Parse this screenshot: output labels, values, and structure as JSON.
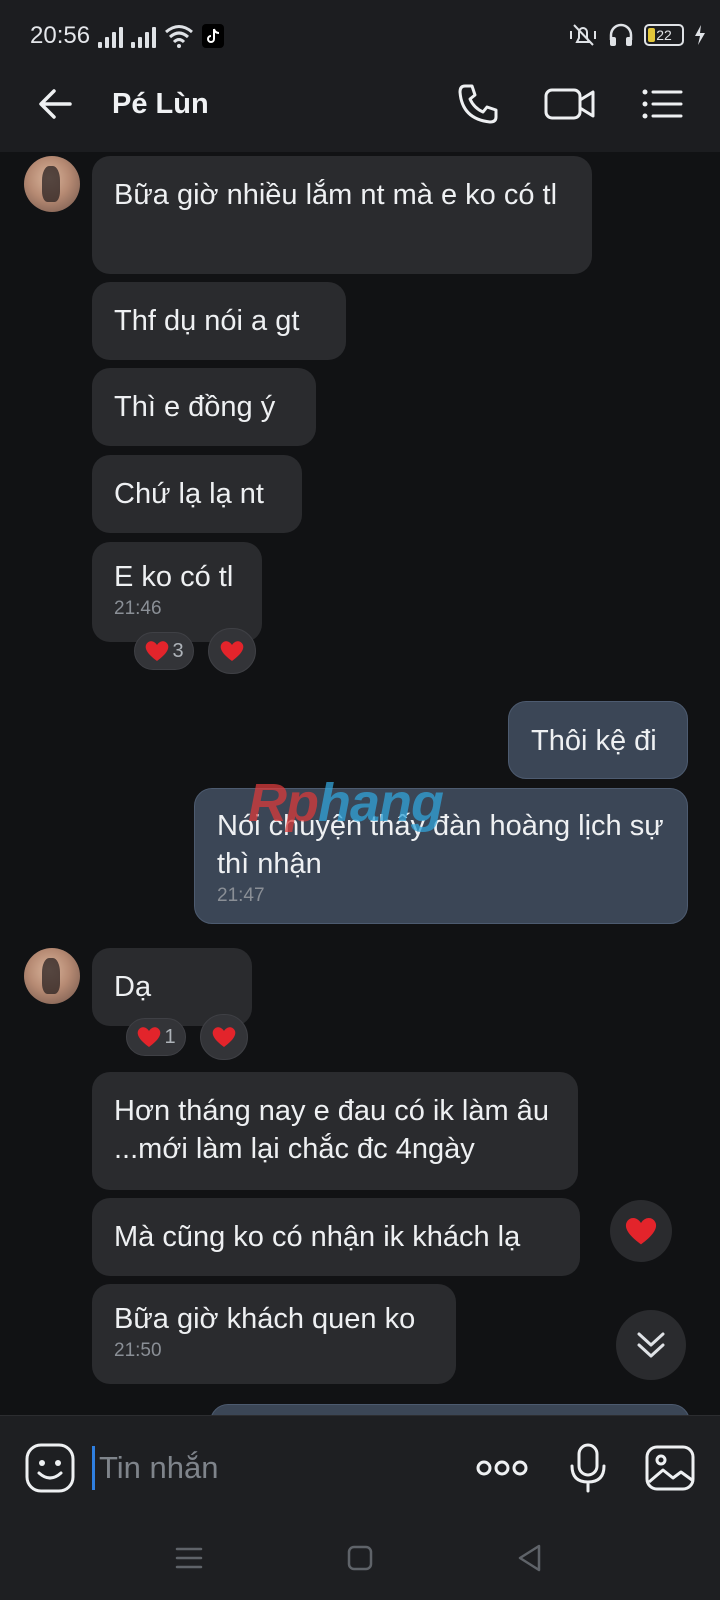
{
  "status_bar": {
    "time": "20:56",
    "battery": "22"
  },
  "header": {
    "contact_name": "Pé Lùn"
  },
  "messages": {
    "m1": {
      "text": "Bữa giờ nhiều lắm nt mà e ko có tl"
    },
    "m2": {
      "text": "Thf dụ nói a gt"
    },
    "m3": {
      "text": "Thì e đồng ý"
    },
    "m4": {
      "text": "Chứ lạ lạ nt"
    },
    "m5": {
      "text": "E ko có tl",
      "time": "21:46",
      "reaction_count": "3"
    },
    "m6": {
      "text": "Thôi kệ đi"
    },
    "m7": {
      "text": "Nói chuyện thấy đàn hoàng lịch sự thì nhận",
      "time": "21:47"
    },
    "m8": {
      "text": "Dạ",
      "reaction_count": "1"
    },
    "m9": {
      "text": "Hơn tháng nay e đau có ik làm âu ...mới làm lại chắc đc 4ngày"
    },
    "m10": {
      "text": "Mà cũng ko có nhận ik khách lạ"
    },
    "m11": {
      "text": "Bữa giờ khách quen ko",
      "time": "21:50"
    }
  },
  "watermark": {
    "part1": "Rp",
    "part2": "hang"
  },
  "input": {
    "placeholder": "Tin nhắn"
  },
  "colors": {
    "accent": "#2f7fe0",
    "heart": "#e3242b",
    "outgoing_bubble": "#3b4656",
    "incoming_bubble": "#2a2b2e"
  }
}
